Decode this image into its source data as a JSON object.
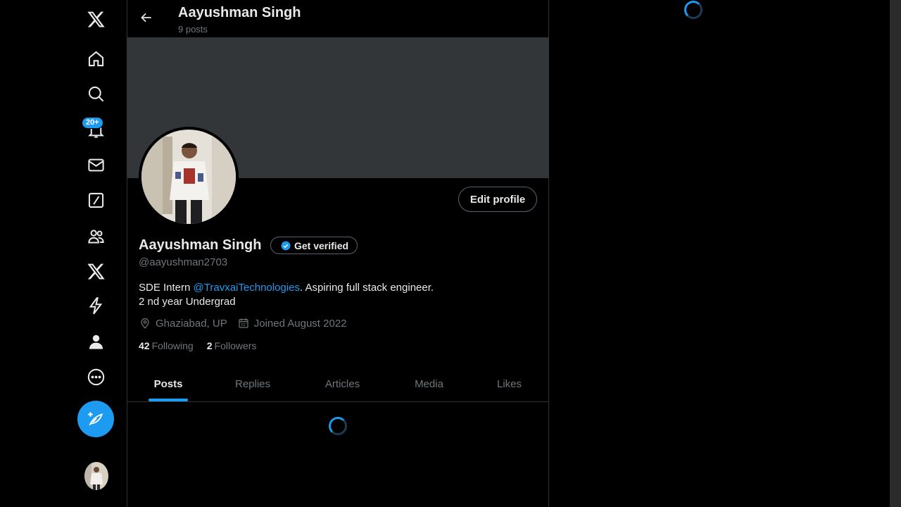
{
  "icons": {
    "logo": "x-logo-icon",
    "home": "home-icon",
    "explore": "search-icon",
    "notifications": "bell-icon",
    "messages": "mail-icon",
    "grok": "grok-slash-icon",
    "communities": "people-icon",
    "premium": "x-logo-icon",
    "verified_orgs": "lightning-icon",
    "profile": "person-icon",
    "more": "more-circle-icon",
    "post": "feather-plus-icon"
  },
  "nav": {
    "notifications_badge": "20+"
  },
  "header": {
    "title": "Aayushman Singh",
    "post_count": "9 posts"
  },
  "profile": {
    "edit_button": "Edit profile",
    "display_name": "Aayushman Singh",
    "get_verified": "Get verified",
    "handle": "@aayushman2703",
    "bio_part1": "SDE Intern ",
    "bio_mention": "@TravxaiTechnologies",
    "bio_part2": ". Aspiring full stack engineer.",
    "bio_line2": "2 nd year Undergrad",
    "location": "Ghaziabad, UP",
    "joined": "Joined August 2022",
    "following_count": "42",
    "following_label": "Following",
    "followers_count": "2",
    "followers_label": "Followers"
  },
  "tabs": [
    {
      "label": "Posts",
      "active": true
    },
    {
      "label": "Replies",
      "active": false
    },
    {
      "label": "Articles",
      "active": false
    },
    {
      "label": "Media",
      "active": false
    },
    {
      "label": "Likes",
      "active": false
    }
  ],
  "colors": {
    "accent": "#1d9bf0",
    "banner": "#333639",
    "muted_text": "#71767b",
    "border": "#2f3336"
  }
}
